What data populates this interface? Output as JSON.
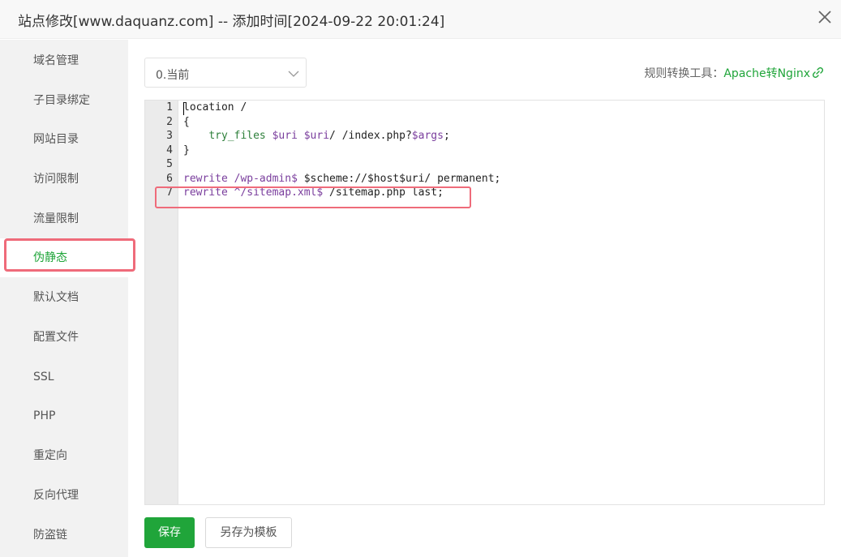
{
  "window": {
    "title": "站点修改[www.daquanz.com] -- 添加时间[2024-09-22 20:01:24]"
  },
  "sidebar": {
    "items": [
      {
        "label": "域名管理"
      },
      {
        "label": "子目录绑定"
      },
      {
        "label": "网站目录"
      },
      {
        "label": "访问限制"
      },
      {
        "label": "流量限制"
      },
      {
        "label": "伪静态",
        "active": true
      },
      {
        "label": "默认文档"
      },
      {
        "label": "配置文件"
      },
      {
        "label": "SSL"
      },
      {
        "label": "PHP"
      },
      {
        "label": "重定向"
      },
      {
        "label": "反向代理"
      },
      {
        "label": "防盗链"
      }
    ]
  },
  "rewrite": {
    "template_select": "0.当前",
    "tool_label": "规则转换工具：",
    "tool_link": "Apache转Nginx",
    "tool_icon": "link-icon"
  },
  "editor": {
    "line_numbers": [
      "1",
      "2",
      "3",
      "4",
      "5",
      "6",
      "7"
    ],
    "lines": [
      {
        "text": "location /"
      },
      {
        "text": "{"
      },
      {
        "indent": "    ",
        "fn": "try_files",
        "v1": "$uri",
        "v2": "$uri",
        "rest": "/ /index.php?",
        "v3": "$args",
        "end": ";"
      },
      {
        "text": "}"
      },
      {
        "text": ""
      },
      {
        "kw": "rewrite",
        "p1": " /wp-admin$ ",
        "rest": "$scheme://$host$uri/ permanent;"
      },
      {
        "kw": "rewrite",
        "p1": " ^/sitemap.xml$ ",
        "rest": "/sitemap.php last;"
      }
    ]
  },
  "buttons": {
    "save": "保存",
    "save_template": "另存为模板"
  },
  "colors": {
    "accent": "#20a53a",
    "highlight": "#ef6b7a",
    "keyword": "#7a3e9d"
  }
}
